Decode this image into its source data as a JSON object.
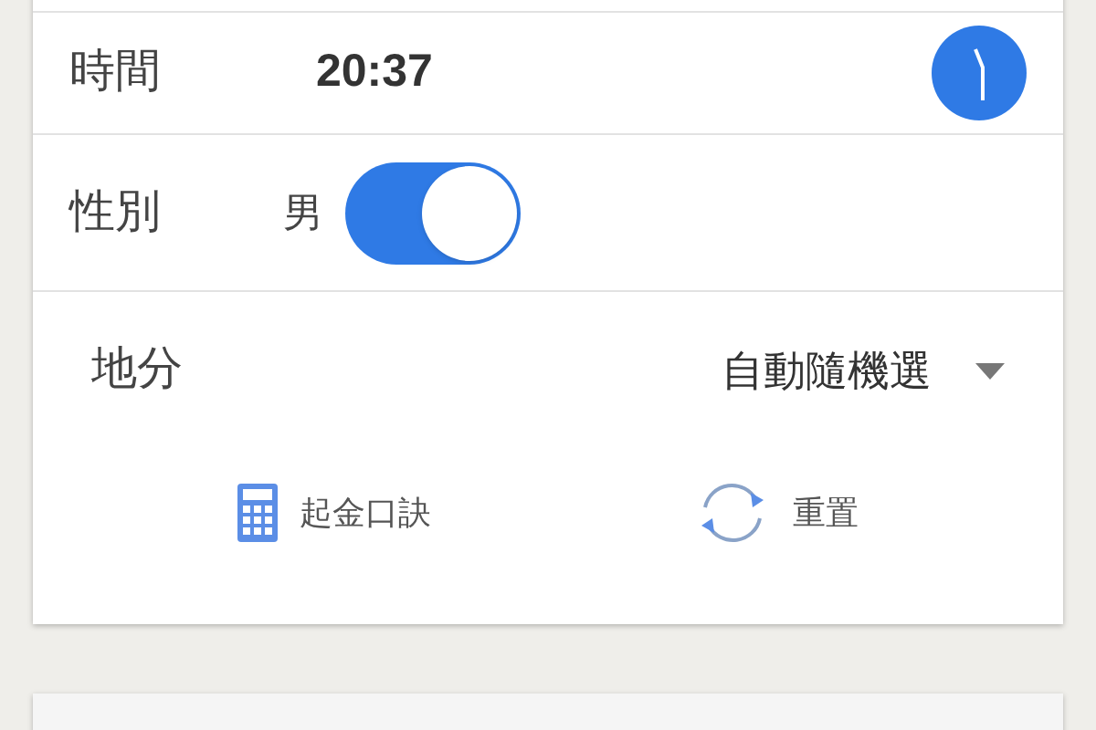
{
  "time_row": {
    "label": "時間",
    "value": "20:37"
  },
  "gender_row": {
    "label": "性別",
    "value": "男",
    "on": true
  },
  "region_row": {
    "label": "地分",
    "value": "自動隨機選"
  },
  "actions": [
    {
      "kind": "calculator",
      "label": "起金口訣"
    },
    {
      "kind": "reset",
      "label": "重置"
    }
  ]
}
